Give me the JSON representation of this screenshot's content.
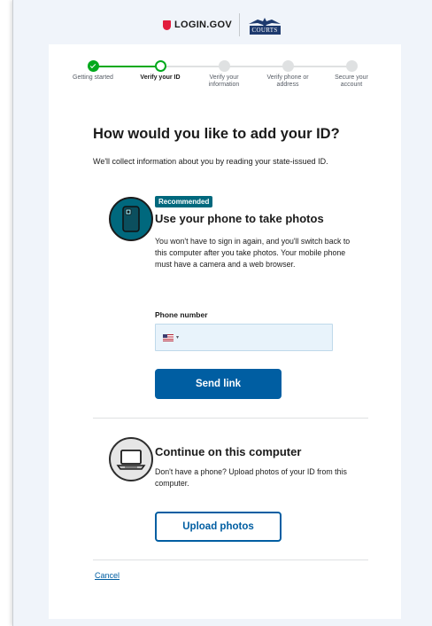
{
  "header": {
    "brand": "LOGIN.GOV",
    "partner_logo_text": "COURTS"
  },
  "steps": [
    {
      "label": "Getting started",
      "status": "complete"
    },
    {
      "label": "Verify your ID",
      "status": "current"
    },
    {
      "label": "Verify your information",
      "status": "upcoming"
    },
    {
      "label": "Verify phone or address",
      "status": "upcoming"
    },
    {
      "label": "Secure your account",
      "status": "upcoming"
    }
  ],
  "page": {
    "title": "How would you like to add your ID?",
    "intro": "We'll collect information about you by reading your state-issued ID."
  },
  "phone_option": {
    "badge": "Recommended",
    "heading": "Use your phone to take photos",
    "description": "You won't have to sign in again, and you'll switch back to this computer after you take photos. Your mobile phone must have a camera and a web browser.",
    "phone_label": "Phone number",
    "phone_value": "",
    "country": "US",
    "button": "Send link",
    "icon": "phone-camera-icon"
  },
  "computer_option": {
    "heading": "Continue on this computer",
    "description": "Don't have a phone? Upload photos of your ID from this computer.",
    "button": "Upload photos",
    "icon": "laptop-icon"
  },
  "cancel": "Cancel",
  "colors": {
    "primary": "#005ea2",
    "success": "#00a91c",
    "badge": "#00687d",
    "brand_red": "#e21c3d",
    "page_bg": "#f0f4fa"
  }
}
